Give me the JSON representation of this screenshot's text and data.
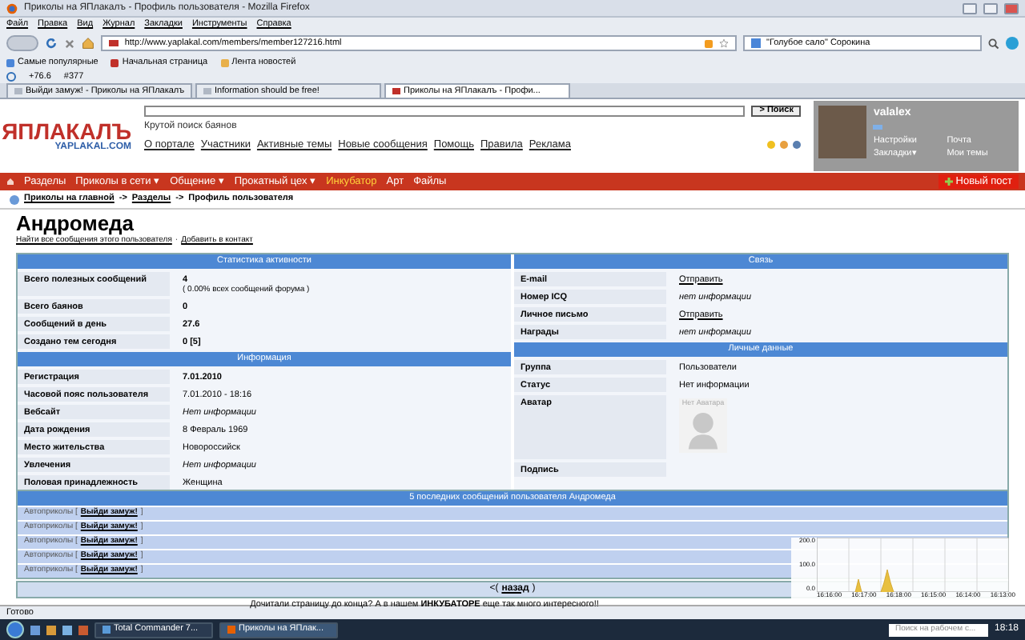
{
  "window": {
    "title": "Приколы на ЯПлакалъ - Профиль пользователя - Mozilla Firefox"
  },
  "menu": [
    "Файл",
    "Правка",
    "Вид",
    "Журнал",
    "Закладки",
    "Инструменты",
    "Справка"
  ],
  "toolbar": {
    "url": "http://www.yaplakal.com/members/member127216.html",
    "search": "\"Голубое сало\" Сорокина"
  },
  "bookmarks": [
    "Самые популярные",
    "Начальная страница",
    "Лента новостей"
  ],
  "extra_toolbar": [
    "+76.6",
    "#377"
  ],
  "tabs": [
    {
      "label": "Выйди замуж! - Приколы на ЯПлакалъ",
      "selected": false
    },
    {
      "label": "Information should be free!",
      "selected": false
    },
    {
      "label": "Приколы на ЯПлакалъ - Профи...",
      "selected": true
    }
  ],
  "site": {
    "logo": "ЯПЛАКАЛЪ",
    "logo_sub": "YAPLAKAL.COM",
    "search_button": "> Поиск",
    "search_hint": "Крутой поиск баянов",
    "links": [
      "О портале",
      "Участники",
      "Активные темы",
      "Новые сообщения",
      "Помощь",
      "Правила",
      "Реклама"
    ],
    "user": {
      "name": "valalex",
      "links": [
        "Настройки",
        "Почта",
        "Закладки▾",
        "Мои темы"
      ]
    }
  },
  "nav": {
    "items": [
      {
        "label": "Разделы",
        "highlight": false
      },
      {
        "label": "Приколы в сети",
        "caret": "▾",
        "highlight": false
      },
      {
        "label": "Общение",
        "caret": "▾",
        "highlight": false
      },
      {
        "label": "Прокатный цех",
        "caret": "▾",
        "highlight": false
      },
      {
        "label": "Инкубатор",
        "highlight": true
      },
      {
        "label": "Арт",
        "highlight": false
      },
      {
        "label": "Файлы",
        "highlight": false
      }
    ],
    "new_post": "Новый пост"
  },
  "breadcrumb": {
    "items": [
      "Приколы на главной",
      "Разделы",
      "Профиль пользователя"
    ],
    "separator": "->"
  },
  "profile": {
    "name": "Андромеда",
    "links": [
      "Найти все сообщения этого пользователя",
      "Добавить в контакт"
    ],
    "link_separator": "·"
  },
  "columns": [
    [
      {
        "title": "Статистика активности",
        "rows": [
          {
            "label": "Всего полезных сообщений",
            "value": "4",
            "note": "( 0.00% всех сообщений форума )",
            "kind": "bold"
          },
          {
            "label": "Всего баянов",
            "value": "0",
            "kind": "bold"
          },
          {
            "label": "Сообщений в день",
            "value": "27.6",
            "kind": "bold"
          },
          {
            "label": "Создано тем сегодня",
            "value": "0 [5]",
            "kind": "bold"
          }
        ]
      },
      {
        "title": "Информация",
        "rows": [
          {
            "label": "Регистрация",
            "value": "7.01.2010",
            "kind": "bold"
          },
          {
            "label": "Часовой пояс пользователя",
            "value": "7.01.2010 - 18:16",
            "kind": "plain"
          },
          {
            "label": "Вебсайт",
            "value": "Нет информации",
            "kind": "italic"
          },
          {
            "label": "Дата рождения",
            "value": "8 Февраль 1969",
            "kind": "plain"
          },
          {
            "label": "Место жительства",
            "value": "Новороссийск",
            "kind": "plain"
          },
          {
            "label": "Увлечения",
            "value": "Нет информации",
            "kind": "italic"
          },
          {
            "label": "Половая принадлежность",
            "value": "Женщина",
            "kind": "plain"
          }
        ]
      }
    ],
    [
      {
        "title": "Связь",
        "rows": [
          {
            "label": "E-mail",
            "value": "Отправить",
            "kind": "link"
          },
          {
            "label": "Номер ICQ",
            "value": "нет информации",
            "kind": "italic"
          },
          {
            "label": "Личное письмо",
            "value": "Отправить",
            "kind": "link"
          },
          {
            "label": "Награды",
            "value": "нет информации",
            "kind": "italic"
          }
        ]
      },
      {
        "title": "Личные данные",
        "rows": [
          {
            "label": "Группа",
            "value": "Пользователи",
            "kind": "plain"
          },
          {
            "label": "Статус",
            "value": "Нет информации",
            "kind": "plain"
          },
          {
            "label": "Аватар",
            "value": "Нет Аватара",
            "kind": "avatar"
          },
          {
            "label": "Подпись",
            "kind": "empty"
          }
        ]
      }
    ]
  ],
  "messages": {
    "title": "5 последних сообщений пользователя Андромеда",
    "items": [
      {
        "section": "Автоприколы [",
        "link": "Выйди замуж!",
        "tail": "]"
      },
      {
        "section": "Автоприколы [",
        "link": "Выйди замуж!",
        "tail": "]"
      },
      {
        "section": "Автоприколы [",
        "link": "Выйди замуж!",
        "tail": "]"
      },
      {
        "section": "Автоприколы [",
        "link": "Выйди замуж!",
        "tail": "]"
      },
      {
        "section": "Автоприколы [",
        "link": "Выйди замуж!",
        "tail": "]"
      }
    ]
  },
  "back": {
    "before": "<(",
    "link": "назад",
    "after": ")"
  },
  "footer": "Дочитали страницу до конца? А в нашем **ИНКУБАТОРЕ** еще так много интересного!!",
  "graph": {
    "y_labels": [
      "200.0",
      "100.0",
      "0.0"
    ],
    "x_labels": [
      "16:16:00",
      "16:17:00",
      "16:18:00",
      "16:15:00",
      "16:14:00",
      "16:13:00"
    ]
  },
  "status_bar": "Готово",
  "taskbar": {
    "windows": [
      {
        "label": "Total Commander 7...",
        "selected": false
      },
      {
        "label": "Приколы на ЯПлак...",
        "selected": true
      }
    ],
    "search": "Поиск на рабочем с...",
    "clock": "18:18"
  }
}
